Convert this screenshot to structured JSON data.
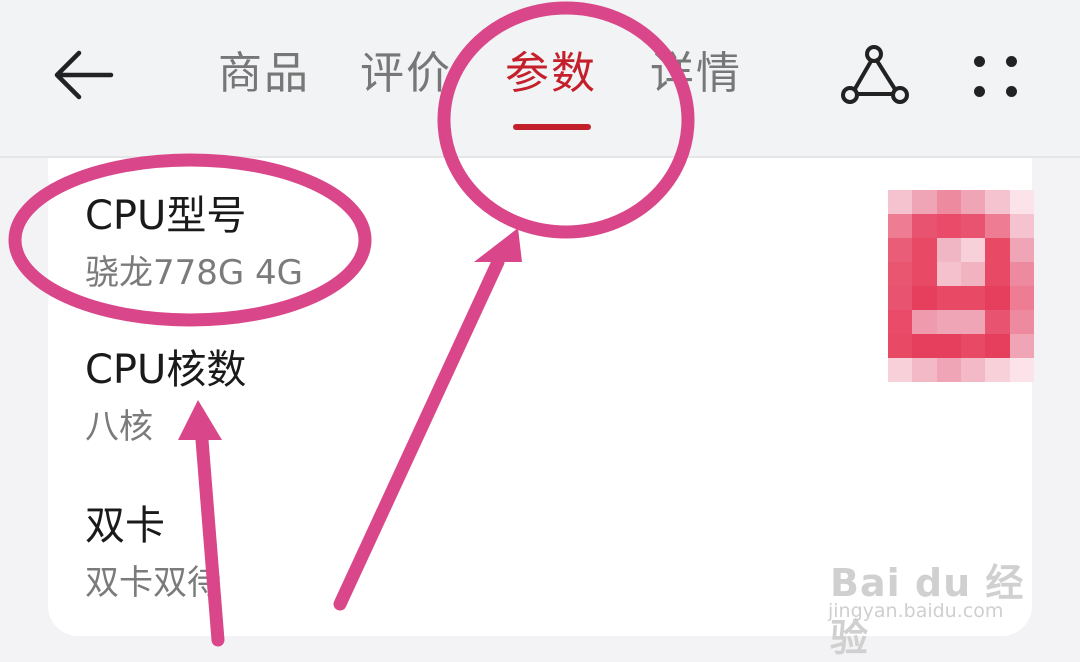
{
  "header": {
    "tabs": [
      {
        "label": "商品"
      },
      {
        "label": "评价"
      },
      {
        "label": "参数"
      },
      {
        "label": "详情"
      }
    ],
    "active_tab": "参数",
    "accent_color": "#c4202c",
    "icons": [
      "back-arrow-icon",
      "share-icon",
      "more-dots-icon"
    ]
  },
  "params": [
    {
      "name": "CPU型号",
      "value": "骁龙778G 4G"
    },
    {
      "name": "CPU核数",
      "value": "八核"
    },
    {
      "name": "双卡",
      "value": "双卡双待"
    }
  ],
  "annotation_color": "#d9478a",
  "watermark": {
    "logo": "Bai du 经验",
    "url": "jingyan.baidu.com"
  }
}
